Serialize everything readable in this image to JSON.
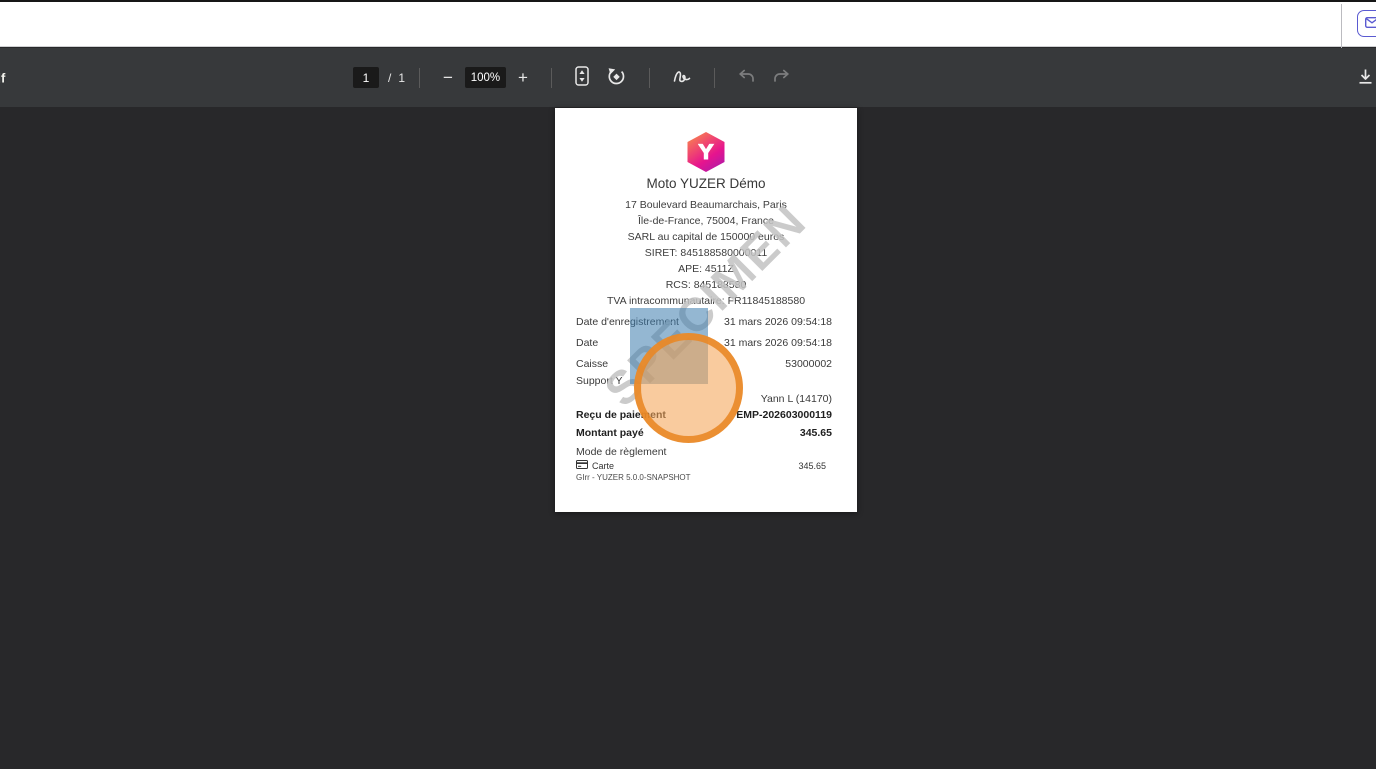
{
  "browser_bar": {
    "mail_button_icon": "envelope"
  },
  "toolbar": {
    "filename_fragment": "df",
    "page_current": "1",
    "page_separator": "/",
    "page_total": "1",
    "zoom_level": "100%"
  },
  "icons": {
    "mail-icon": "envelope outline in rounded purple button",
    "minus-icon": "−",
    "plus-icon": "+",
    "fit-page-icon": "page with up/down arrows",
    "rotate-icon": "counterclockwise circular arrow around square",
    "annotate-icon": "pen squiggle",
    "undo-icon": "curved arrow left",
    "redo-icon": "curved arrow right",
    "download-icon": "down arrow into tray",
    "card-icon": "credit card"
  },
  "colors": {
    "toolbar_bg": "#37393b",
    "viewer_bg": "#28282a",
    "accent_purple": "#5a5ad1",
    "overlay_blue": "rgba(60,124,173,0.55)",
    "overlay_orange_border": "#e98623",
    "logo_gradient": [
      "#f98a4b",
      "#e6148e",
      "#a21caf"
    ]
  },
  "receipt": {
    "merchant_name": "Moto YUZER Démo",
    "address_lines": [
      "17 Boulevard Beaumarchais, Paris",
      "Île-de-France, 75004, France",
      "SARL au capital de 150000 euros",
      "SIRET: 845188580000011",
      "APE: 4511Z",
      "RCS: 845188580",
      "TVA intracommunautaire: FR11845188580"
    ],
    "rows": [
      {
        "label": "Date d'enregistrement",
        "value": "31 mars 2026 09:54:18"
      },
      {
        "label": "Date",
        "value": "31 mars 2026 09:54:18"
      },
      {
        "label": "Caisse",
        "value": "53000002"
      },
      {
        "label": "Support Y",
        "value": ""
      },
      {
        "label": "",
        "value": "Yann L (14170)"
      },
      {
        "label": "Reçu de paiement",
        "value": "EMP-202603000119"
      },
      {
        "label": "Montant payé",
        "value": "345.65"
      }
    ],
    "payment_section": {
      "label": "Mode de règlement",
      "method": "Carte",
      "amount": "345.65"
    },
    "footer": "GIrr - YUZER 5.0.0-SNAPSHOT",
    "watermark": "SPECIMEN"
  }
}
